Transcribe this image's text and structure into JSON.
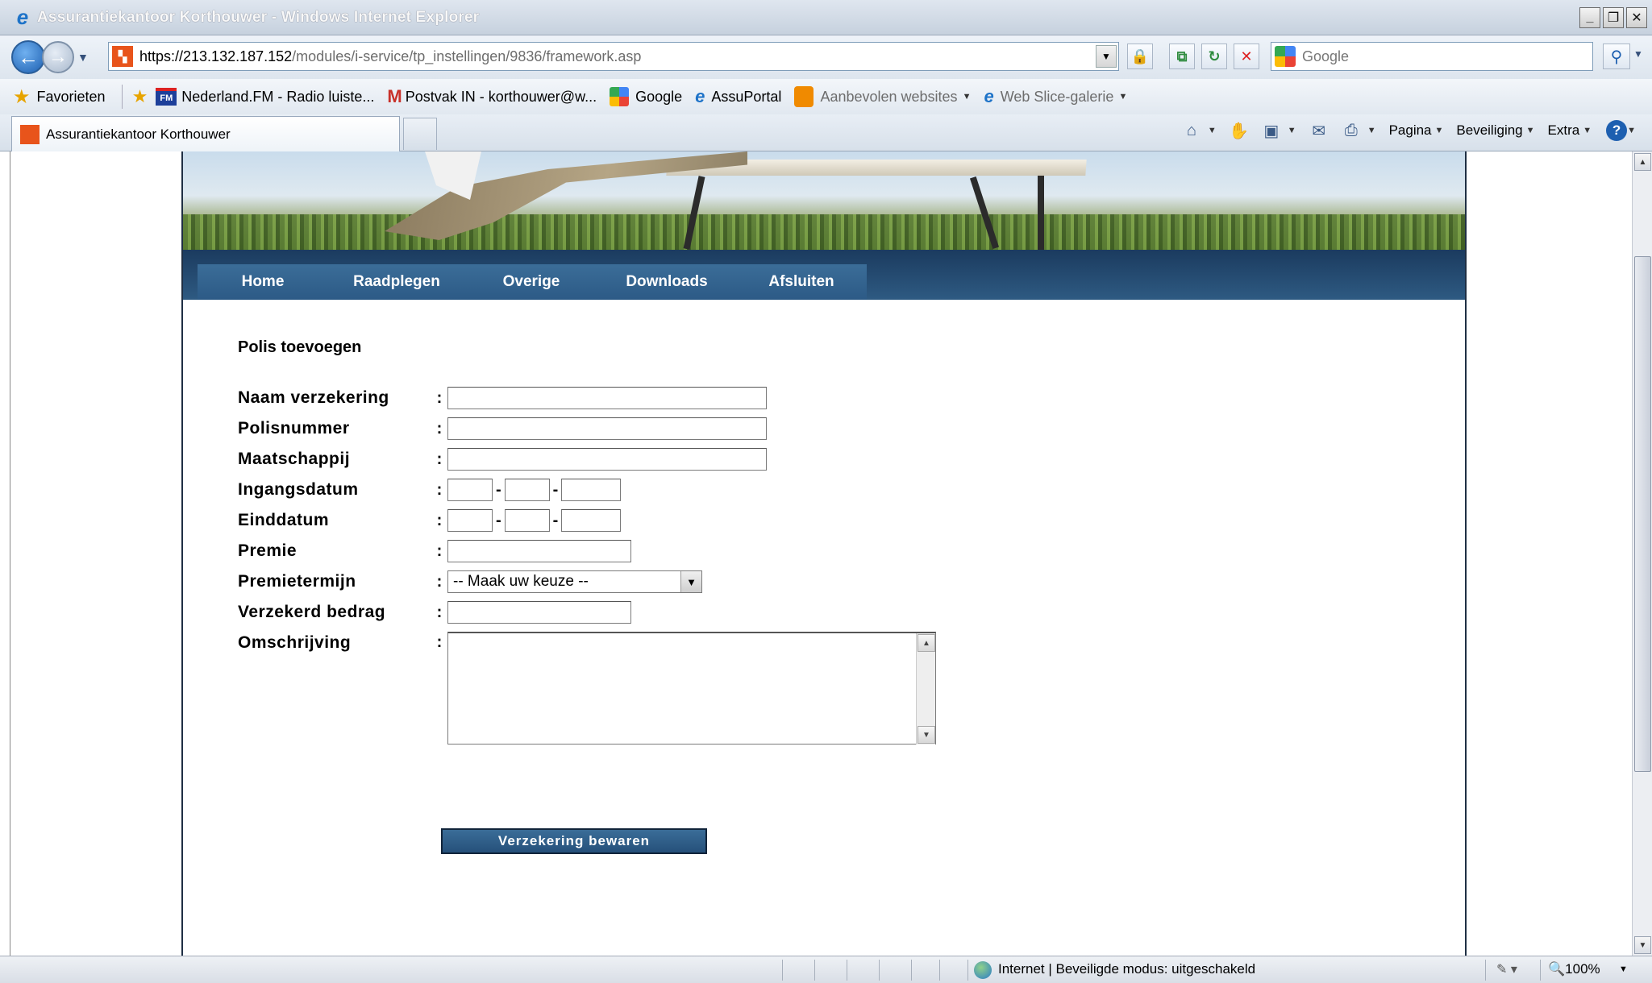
{
  "window": {
    "title": "Assurantiekantoor Korthouwer - Windows Internet Explorer",
    "controls": {
      "minimize": "_",
      "restore": "❐",
      "close": "✕"
    }
  },
  "address": {
    "url_host": "https://213.132.187.152",
    "url_path": "/modules/i-service/tp_instellingen/9836/framework.asp",
    "search_placeholder": "Google"
  },
  "favorites": {
    "label": "Favorieten",
    "items": [
      {
        "label": "Nederland.FM - Radio luiste...",
        "icon": "fm-icon"
      },
      {
        "label": "Postvak IN - korthouwer@w...",
        "icon": "mail-icon"
      },
      {
        "label": "Google",
        "icon": "google-icon"
      },
      {
        "label": "AssuPortal",
        "icon": "ie-icon"
      },
      {
        "label": "Aanbevolen websites",
        "icon": "recommended-icon"
      },
      {
        "label": "Web Slice-galerie",
        "icon": "ie-icon"
      }
    ]
  },
  "tabs": {
    "active_label": "Assurantiekantoor Korthouwer"
  },
  "commandbar": {
    "page": "Pagina",
    "security": "Beveiliging",
    "extra": "Extra"
  },
  "site": {
    "nav": [
      "Home",
      "Raadplegen",
      "Overige",
      "Downloads",
      "Afsluiten"
    ]
  },
  "form": {
    "title": "Polis toevoegen",
    "labels": {
      "naam": "Naam verzekering",
      "polisnummer": "Polisnummer",
      "maatschappij": "Maatschappij",
      "ingangsdatum": "Ingangsdatum",
      "einddatum": "Einddatum",
      "premie": "Premie",
      "premietermijn": "Premietermijn",
      "verzekerd_bedrag": "Verzekerd bedrag",
      "omschrijving": "Omschrijving"
    },
    "separator": ":",
    "date_dash": "-",
    "premietermijn_selected": "-- Maak uw keuze --",
    "save_label": "Verzekering bewaren"
  },
  "status": {
    "zone": "Internet | Beveiligde modus: uitgeschakeld",
    "zoom": "100%"
  }
}
